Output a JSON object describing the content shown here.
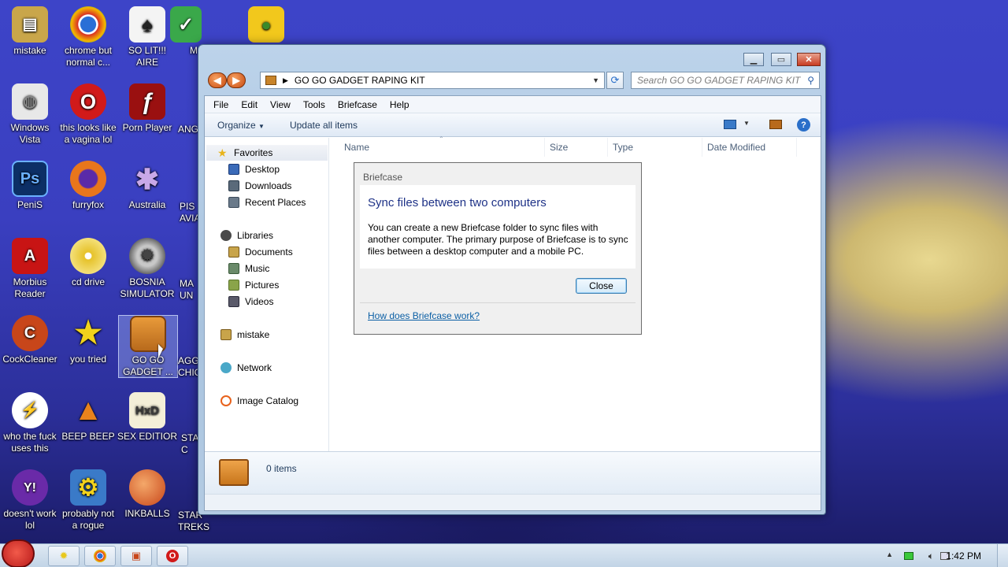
{
  "desktop": {
    "icons": [
      {
        "label": "mistake",
        "color": "#c9a64a",
        "glyph": "▤"
      },
      {
        "label": "chrome but normal c...",
        "color": "#2f8f3d",
        "glyph": "◉"
      },
      {
        "label": "SO LIT!!! AIRE",
        "color": "#e8e8e8",
        "glyph": "♠"
      },
      {
        "label": "Windows Vista",
        "color": "#e8e8e8",
        "glyph": "◍"
      },
      {
        "label": "this looks like a vagina lol",
        "color": "#d11a1a",
        "glyph": "O"
      },
      {
        "label": "Porn Player",
        "color": "#9a1010",
        "glyph": "ƒ"
      },
      {
        "label": "PeniS",
        "color": "#0c2f66",
        "glyph": "Ps"
      },
      {
        "label": "furryfox",
        "color": "#e8761c",
        "glyph": "◉"
      },
      {
        "label": "Australia",
        "color": "#8a3aa8",
        "glyph": "✱"
      },
      {
        "label": "Morbius Reader",
        "color": "#c81414",
        "glyph": "A"
      },
      {
        "label": "cd drive",
        "color": "#e6c22a",
        "glyph": "◎"
      },
      {
        "label": "BOSNIA SIMULATOR",
        "color": "#7a7a7a",
        "glyph": "✹"
      },
      {
        "label": "CockCleaner",
        "color": "#c8461a",
        "glyph": "C"
      },
      {
        "label": "you tried",
        "color": "#e8c81c",
        "glyph": "★"
      },
      {
        "label": "GO GO GADGET ...",
        "color": "#b86a1c",
        "glyph": "▣"
      },
      {
        "label": "who the fuck uses this",
        "color": "#e8621c",
        "glyph": "⚡"
      },
      {
        "label": "BEEP BEEP",
        "color": "#e8821c",
        "glyph": "▲"
      },
      {
        "label": "SEX EDITIOR",
        "color": "#c8b46a",
        "glyph": "HxD"
      },
      {
        "label": "doesn't work lol",
        "color": "#6a2aa8",
        "glyph": "Y!"
      },
      {
        "label": "probably not a rogue",
        "color": "#3a7ac8",
        "glyph": "⚙"
      },
      {
        "label": "INKBALLS",
        "color": "#d8641c",
        "glyph": "●"
      }
    ],
    "partial_labels": [
      "M",
      "ANG",
      "PIS AVIA",
      "MA UN",
      "AGG CHIC",
      "STA C",
      "STAR TREKS"
    ]
  },
  "explorer": {
    "address_path": "GO GO GADGET RAPING KIT",
    "search_placeholder": "Search GO GO GADGET RAPING KIT",
    "menu": [
      "File",
      "Edit",
      "View",
      "Tools",
      "Briefcase",
      "Help"
    ],
    "toolbar": {
      "organize": "Organize",
      "update_all": "Update all items"
    },
    "nav": {
      "favorites": "Favorites",
      "desktop": "Desktop",
      "downloads": "Downloads",
      "recent_places": "Recent Places",
      "libraries": "Libraries",
      "documents": "Documents",
      "music": "Music",
      "pictures": "Pictures",
      "videos": "Videos",
      "user": "mistake",
      "network": "Network",
      "image_catalog": "Image Catalog"
    },
    "columns": [
      "Name",
      "Size",
      "Type",
      "Date Modified"
    ],
    "status_items": "0 items"
  },
  "dialog": {
    "title": "Briefcase",
    "heading": "Sync files between two computers",
    "body": "You can create a new Briefcase folder to sync files with another computer. The primary purpose of Briefcase is to sync files between a desktop computer and a mobile PC.",
    "close_label": "Close",
    "link": "How does Briefcase work?"
  },
  "taskbar": {
    "clock": "1:42 PM"
  },
  "colors": {
    "wallpaper": "#3a3fc0",
    "dialog_heading": "#1e3287",
    "link": "#0b5fa5"
  }
}
